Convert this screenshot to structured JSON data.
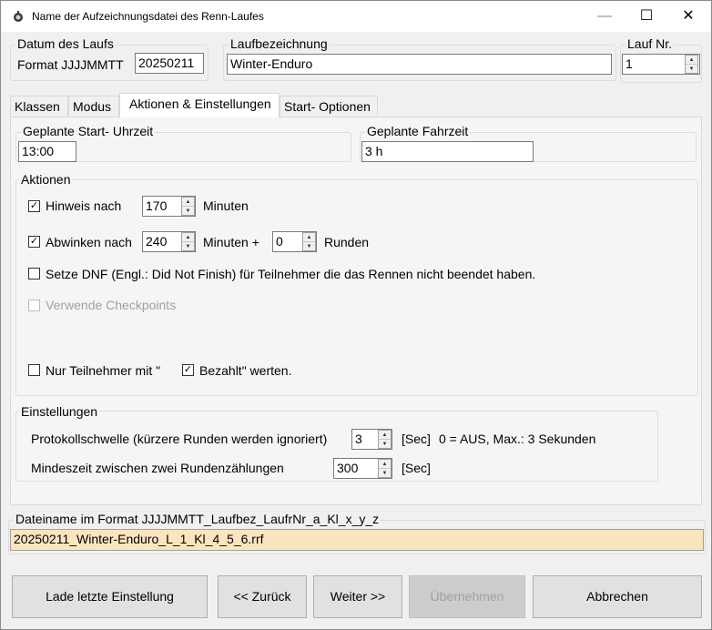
{
  "window": {
    "title": "Name der Aufzeichnungsdatei des Renn-Laufes",
    "minimize_glyph": "—",
    "maximize_glyph": "☐",
    "close_glyph": "✕",
    "icon": "app-icon"
  },
  "header": {
    "date_group_label": "Datum des Laufs",
    "date_format_label": "Format JJJJMMTT",
    "date_value": "20250211",
    "run_name_group_label": "Laufbezeichnung",
    "run_name_value": "Winter-Enduro",
    "run_no_group_label": "Lauf Nr.",
    "run_no_value": "1"
  },
  "tabs": [
    {
      "label": "Klassen",
      "active": false
    },
    {
      "label": "Modus",
      "active": false
    },
    {
      "label": "Aktionen & Einstellungen",
      "active": true
    },
    {
      "label": "Start- Optionen",
      "active": false
    }
  ],
  "schedule": {
    "start_time_label": "Geplante Start- Uhrzeit",
    "start_time_value": "13:00",
    "duration_label": "Geplante Fahrzeit",
    "duration_value": "3 h"
  },
  "actions": {
    "group_label": "Aktionen",
    "notice_label": "Hinweis nach",
    "notice_checked": true,
    "notice_value": "170",
    "notice_unit": "Minuten",
    "wave_label": "Abwinken nach",
    "wave_checked": true,
    "wave_minutes_value": "240",
    "wave_minutes_unit": "Minuten +",
    "wave_laps_value": "0",
    "wave_laps_unit": "Runden",
    "dnf_label": "Setze DNF (Engl.: Did Not Finish) für Teilnehmer die das Rennen nicht beendet haben.",
    "dnf_checked": false,
    "checkpoints_label": "Verwende Checkpoints",
    "checkpoints_checked": false,
    "checkpoints_enabled": false,
    "only_participants_label": "Nur Teilnehmer mit \"",
    "only_participants_checked": false,
    "paid_label": "Bezahlt\" werten.",
    "paid_checked": true
  },
  "settings": {
    "group_label": "Einstellungen",
    "threshold_label": "Protokollschwelle (kürzere Runden werden ignoriert)",
    "threshold_value": "3",
    "threshold_unit": "[Sec]",
    "threshold_hint": "0 = AUS, Max.: 3 Sekunden",
    "min_time_label": "Mindeszeit zwischen zwei Rundenzählungen",
    "min_time_value": "300",
    "min_time_unit": "[Sec]"
  },
  "filename": {
    "label": "Dateiname im Format JJJJMMTT_Laufbez_LaufrNr_a_Kl_x_y_z",
    "value": "20250211_Winter-Enduro_L_1_Kl_4_5_6.rrf"
  },
  "buttons": {
    "load_last": "Lade letzte Einstellung",
    "back": "<< Zurück",
    "next": "Weiter >>",
    "apply": "Übernehmen",
    "cancel": "Abbrechen"
  },
  "glyphs": {
    "check": "✓",
    "spin_up": "▲",
    "spin_down": "▼"
  }
}
